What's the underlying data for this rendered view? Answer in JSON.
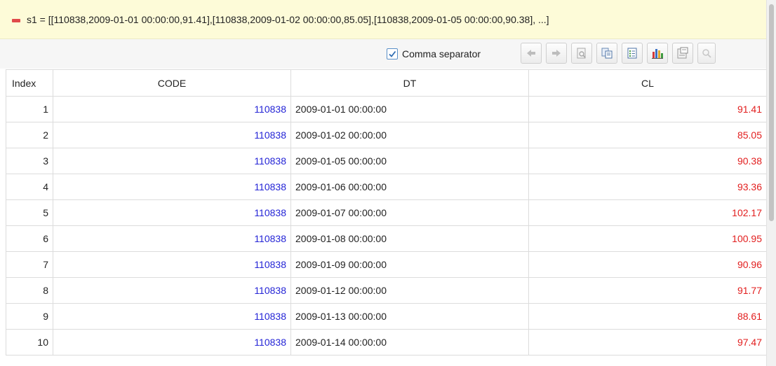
{
  "header": {
    "text": "s1 = [[110838,2009-01-01 00:00:00,91.41],[110838,2009-01-02 00:00:00,85.05],[110838,2009-01-05 00:00:00,90.38], ...]"
  },
  "toolbar": {
    "comma_separator_label": "Comma separator",
    "comma_separator_checked": true
  },
  "table": {
    "columns": [
      "Index",
      "CODE",
      "DT",
      "CL"
    ],
    "rows": [
      {
        "index": "1",
        "code": "110838",
        "dt": "2009-01-01 00:00:00",
        "cl": "91.41"
      },
      {
        "index": "2",
        "code": "110838",
        "dt": "2009-01-02 00:00:00",
        "cl": "85.05"
      },
      {
        "index": "3",
        "code": "110838",
        "dt": "2009-01-05 00:00:00",
        "cl": "90.38"
      },
      {
        "index": "4",
        "code": "110838",
        "dt": "2009-01-06 00:00:00",
        "cl": "93.36"
      },
      {
        "index": "5",
        "code": "110838",
        "dt": "2009-01-07 00:00:00",
        "cl": "102.17"
      },
      {
        "index": "6",
        "code": "110838",
        "dt": "2009-01-08 00:00:00",
        "cl": "100.95"
      },
      {
        "index": "7",
        "code": "110838",
        "dt": "2009-01-09 00:00:00",
        "cl": "90.96"
      },
      {
        "index": "8",
        "code": "110838",
        "dt": "2009-01-12 00:00:00",
        "cl": "91.77"
      },
      {
        "index": "9",
        "code": "110838",
        "dt": "2009-01-13 00:00:00",
        "cl": "88.61"
      },
      {
        "index": "10",
        "code": "110838",
        "dt": "2009-01-14 00:00:00",
        "cl": "97.47"
      }
    ]
  },
  "colors": {
    "header_background": "#fdfbd8",
    "collapse_icon": "#e04a4a",
    "code_text": "#2424d6",
    "cl_text": "#e21e1e",
    "grid_line": "#dcdcdc"
  },
  "icons": [
    "collapse-icon",
    "checkbox-check-icon",
    "arrow-left-icon",
    "arrow-right-icon",
    "preview-icon",
    "copy-icon",
    "list-icon",
    "bar-chart-icon",
    "properties-icon",
    "search-icon"
  ]
}
